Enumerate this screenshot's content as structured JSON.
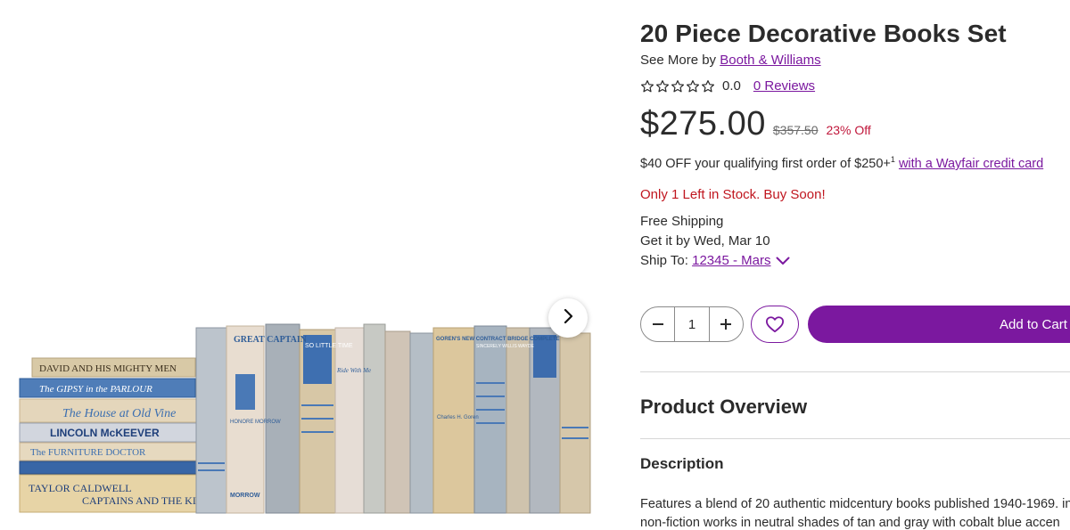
{
  "product": {
    "title": "20 Piece Decorative Books Set",
    "see_more_prefix": "See More by",
    "brand": "Booth & Williams",
    "rating_score": "0.0",
    "rating_stars": 0,
    "reviews_link": "0 Reviews",
    "price": "$275.00",
    "original_price": "$357.50",
    "discount": "23% Off",
    "promo_text": "$40 OFF your qualifying first order of $250+",
    "promo_sup": "1",
    "promo_link": "with a Wayfair credit card",
    "stock_text": "Only 1 Left in Stock. Buy Soon!",
    "shipping": "Free Shipping",
    "delivery": "Get it by Wed, Mar 10",
    "ship_to_label": "Ship To:",
    "ship_to_value": "12345 - Mars",
    "quantity": "1",
    "add_to_cart": "Add to Cart"
  },
  "overview": {
    "heading": "Product Overview",
    "description_heading": "Description",
    "description_line1": "Features a blend of 20 authentic midcentury books published 1940-1969. in",
    "description_line2": "non-fiction works in neutral shades of tan and gray with cobalt blue accen"
  },
  "colors": {
    "accent": "#7b189f",
    "sale": "#c0163a",
    "stock_warning": "#c0161f"
  },
  "gallery": {
    "next_icon": "chevron-right-icon",
    "stacked_books": [
      "DAVID AND HIS MIGHTY MEN",
      "The GIPSY in the PARLOUR",
      "The House at Old Vine",
      "LINCOLN McKEEVER",
      "The FURNITURE DOCTOR",
      "TAYLOR CALDWELL",
      "CAPTAINS AND THE KINGS"
    ],
    "standing_books": [
      "GREAT CAPTAIN",
      "HONORE MORROW",
      "SO LITTLE TIME",
      "Ride With Me",
      "GOREN'S NEW CONTRACT BRIDGE COMPLETE",
      "Charles H. Goren",
      "SINCERELY WILLIS WAYDE",
      "MORROW"
    ]
  }
}
